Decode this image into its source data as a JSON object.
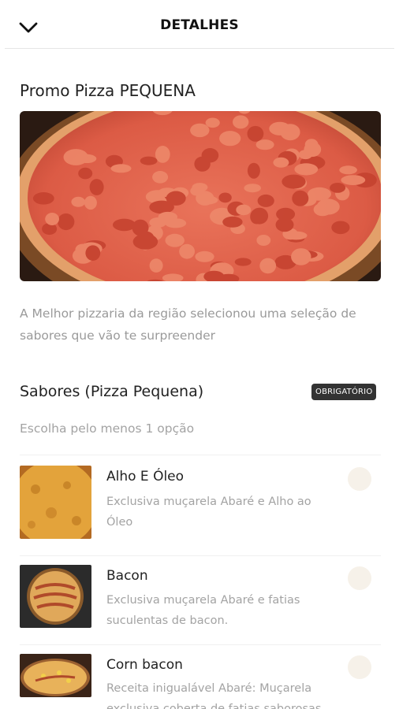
{
  "header": {
    "title": "DETALHES",
    "back_icon": "chevron-down-icon"
  },
  "product": {
    "title": "Promo Pizza PEQUENA",
    "description": "A Melhor pizzaria da região selecionou uma seleção de sabores que vão te surpreender"
  },
  "section": {
    "title": "Sabores (Pizza Pequena)",
    "badge": "OBRIGATÓRIO",
    "subtitle": "Escolha pelo menos 1 opção"
  },
  "items": [
    {
      "name": "Alho E Óleo",
      "description": "Exclusiva muçarela Abaré e Alho ao Óleo"
    },
    {
      "name": "Bacon",
      "description": "Exclusiva muçarela Abaré e fatias suculentas de bacon."
    },
    {
      "name": "Corn bacon",
      "description": "Receita inigualável Abaré: Muçarela exclusiva coberta de fatias saborosas de"
    }
  ],
  "colors": {
    "accent_dark": "#333333",
    "radio_fill": "#f6f1e9",
    "muted_text": "#9a9a9a"
  }
}
